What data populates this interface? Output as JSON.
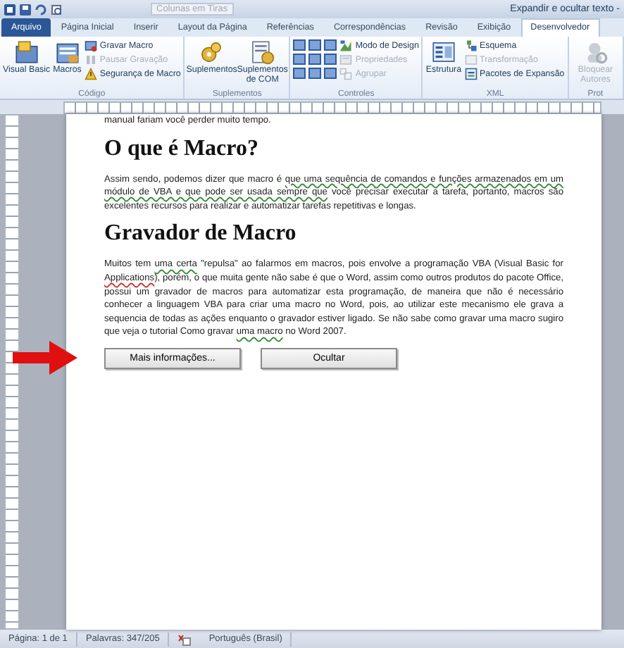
{
  "window": {
    "title": "Expandir e ocultar texto -",
    "quick_access_field": "Colunas em Tiras"
  },
  "tabs": [
    {
      "label": "Arquivo",
      "kind": "file",
      "selected": false
    },
    {
      "label": "Página Inicial",
      "kind": "tab",
      "selected": false
    },
    {
      "label": "Inserir",
      "kind": "tab",
      "selected": false
    },
    {
      "label": "Layout da Página",
      "kind": "tab",
      "selected": false
    },
    {
      "label": "Referências",
      "kind": "tab",
      "selected": false
    },
    {
      "label": "Correspondências",
      "kind": "tab",
      "selected": false
    },
    {
      "label": "Revisão",
      "kind": "tab",
      "selected": false
    },
    {
      "label": "Exibição",
      "kind": "tab",
      "selected": false
    },
    {
      "label": "Desenvolvedor",
      "kind": "tab",
      "selected": true
    }
  ],
  "ribbon_groups": [
    {
      "label": "Código",
      "kind": "standard",
      "large": [
        {
          "label": "Visual Basic",
          "disabled": false
        },
        {
          "label": "Macros",
          "disabled": false
        }
      ],
      "small": [
        {
          "label": "Gravar Macro",
          "disabled": false
        },
        {
          "label": "Pausar Gravação",
          "disabled": true
        },
        {
          "label": "Segurança de Macro",
          "disabled": false
        }
      ]
    },
    {
      "label": "Suplementos",
      "kind": "standard",
      "large": [
        {
          "label": "Suplementos",
          "disabled": false
        },
        {
          "label": "Suplementos de COM",
          "disabled": false
        }
      ]
    },
    {
      "label": "Controles",
      "kind": "controls",
      "small": [
        {
          "label": "Modo de Design",
          "disabled": false
        },
        {
          "label": "Propriedades",
          "disabled": true
        },
        {
          "label": "Agrupar",
          "disabled": true
        }
      ]
    },
    {
      "label": "XML",
      "kind": "standard",
      "large": [
        {
          "label": "Estrutura",
          "disabled": false
        }
      ],
      "small": [
        {
          "label": "Esquema",
          "disabled": false
        },
        {
          "label": "Transformação",
          "disabled": true
        },
        {
          "label": "Pacotes de Expansão",
          "disabled": false
        }
      ]
    },
    {
      "label": "Prot",
      "kind": "standard",
      "large": [
        {
          "label": "Bloquear Autores",
          "disabled": true
        }
      ]
    }
  ],
  "document": {
    "blocks": [
      {
        "kind": "para",
        "segments": [
          {
            "text": "manual fariam você perder muito tempo.",
            "kind": "plain"
          }
        ]
      },
      {
        "kind": "heading",
        "text": "O que é Macro?"
      },
      {
        "kind": "para",
        "segments": [
          {
            "text": "Assim sendo, podemos dizer que macro é ",
            "kind": "plain"
          },
          {
            "text": "que uma sequência de comandos e funções armazenados em um módulo de VBA e que pode ser usada sempre que",
            "kind": "grammar"
          },
          {
            "text": " você precisar executar a tarefa, portanto, macros são excelentes recursos para realizar e automatizar tarefas repetitivas e longas.",
            "kind": "plain"
          }
        ]
      },
      {
        "kind": "heading",
        "text": "Gravador de Macro"
      },
      {
        "kind": "para",
        "segments": [
          {
            "text": "Muitos tem ",
            "kind": "plain"
          },
          {
            "text": "uma certa",
            "kind": "grammar"
          },
          {
            "text": " \"repulsa\" ao falarmos em macros, pois envolve a programação VBA (Visual Basic for ",
            "kind": "plain"
          },
          {
            "text": "Applications",
            "kind": "spelling"
          },
          {
            "text": "), porém, o que muita gente não sabe é que o Word, assim como outros produtos do pacote Office, possui um gravador de macros para automatizar esta programação, de maneira que não é necessário conhecer a linguagem VBA para criar uma macro no Word, pois, ao utilizar este mecanismo ele grava a sequencia de todas as ações enquanto o gravador estiver ligado. Se não sabe como gravar uma macro sugiro que veja o tutorial Como gravar ",
            "kind": "plain"
          },
          {
            "text": "uma macro",
            "kind": "grammar"
          },
          {
            "text": " no Word 2007.",
            "kind": "plain"
          }
        ]
      },
      {
        "kind": "buttons",
        "buttons": [
          "Mais informações...",
          "Ocultar"
        ]
      }
    ]
  },
  "status_bar": [
    {
      "text": "Página: 1 de 1",
      "kind": "text"
    },
    {
      "text": "Palavras: 347/205",
      "kind": "text"
    },
    {
      "kind": "spell"
    },
    {
      "text": "Português (Brasil)",
      "kind": "text"
    }
  ]
}
